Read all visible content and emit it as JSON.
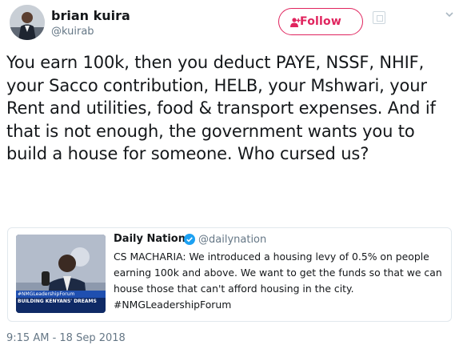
{
  "author": {
    "name": "brian kuira",
    "handle": "@kuirab"
  },
  "follow_button": {
    "label": "Follow",
    "color": "#e0245e"
  },
  "tweet": {
    "text": "You earn 100k, then you deduct PAYE, NSSF, NHIF, your Sacco contribution, HELB, your Mshwari, your Rent and utilities, food & transport expenses. And if that is not enough, the government wants you to build a house for someone. Who cursed us?",
    "timestamp": "9:15 AM - 18 Sep 2018"
  },
  "quoted_tweet": {
    "author_name": "Daily Nation",
    "handle": "@dailynation",
    "verified": true,
    "text": "CS MACHARIA: We introduced a housing levy  of 0.5% on people earning 100k and above. We want to get the funds so that we can house those that can't afford housing in the city. #NMGLeadershipForum",
    "media_caption_line1": "#NMGLeadershipForum",
    "media_caption_line2": "BUILDING KENYANS' DREAMS"
  },
  "icons": {
    "avatar": "avatar-photo",
    "follow": "add-person-icon",
    "verified": "verified-badge-icon",
    "caret": "chevron-down-icon"
  }
}
